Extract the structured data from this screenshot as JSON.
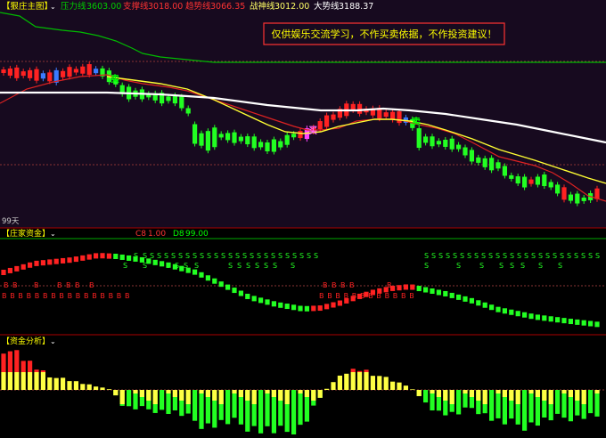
{
  "main_panel": {
    "title": "【狠庄主图】",
    "indicators": [
      {
        "name": "压力线",
        "value": "3603.00",
        "color": "#00cc00"
      },
      {
        "name": "支撑线",
        "value": "3018.00",
        "color": "#ff3333"
      },
      {
        "name": "趋势线",
        "value": "3066.35",
        "color": "#ff3333"
      },
      {
        "name": "战神线",
        "value": "3012.00",
        "color": "#ffff66"
      },
      {
        "name": "大势线",
        "value": "3188.37",
        "color": "#ffffff"
      }
    ],
    "notice": "仅供娱乐交流学习，不作买卖依据，不作投资建议！",
    "period_label": "99天",
    "markers": [
      {
        "label": "卖",
        "color": "#00ff00"
      },
      {
        "label": "买",
        "color": "#ff66ff"
      },
      {
        "label": "卖",
        "color": "#00ff00"
      }
    ]
  },
  "panel2": {
    "title": "【庄家资金】",
    "indicators": [
      {
        "name": "C8",
        "value": "1.00",
        "color": "#ff3333"
      },
      {
        "name": "D8",
        "value": "99.00",
        "color": "#00ff00"
      }
    ],
    "s_marker": "S",
    "b_marker": "B"
  },
  "panel3": {
    "title": "【资金分析】"
  },
  "colors": {
    "background": "#000000",
    "main_background": "#170a1f",
    "up": "#ff2222",
    "down": "#22ff22",
    "trend": "#ffff33",
    "big_trend": "#ffffff",
    "pressure": "#00bb00",
    "notice_border": "#ff3333",
    "notice_text": "#ffff00",
    "highlight": "#3a7bff"
  }
}
